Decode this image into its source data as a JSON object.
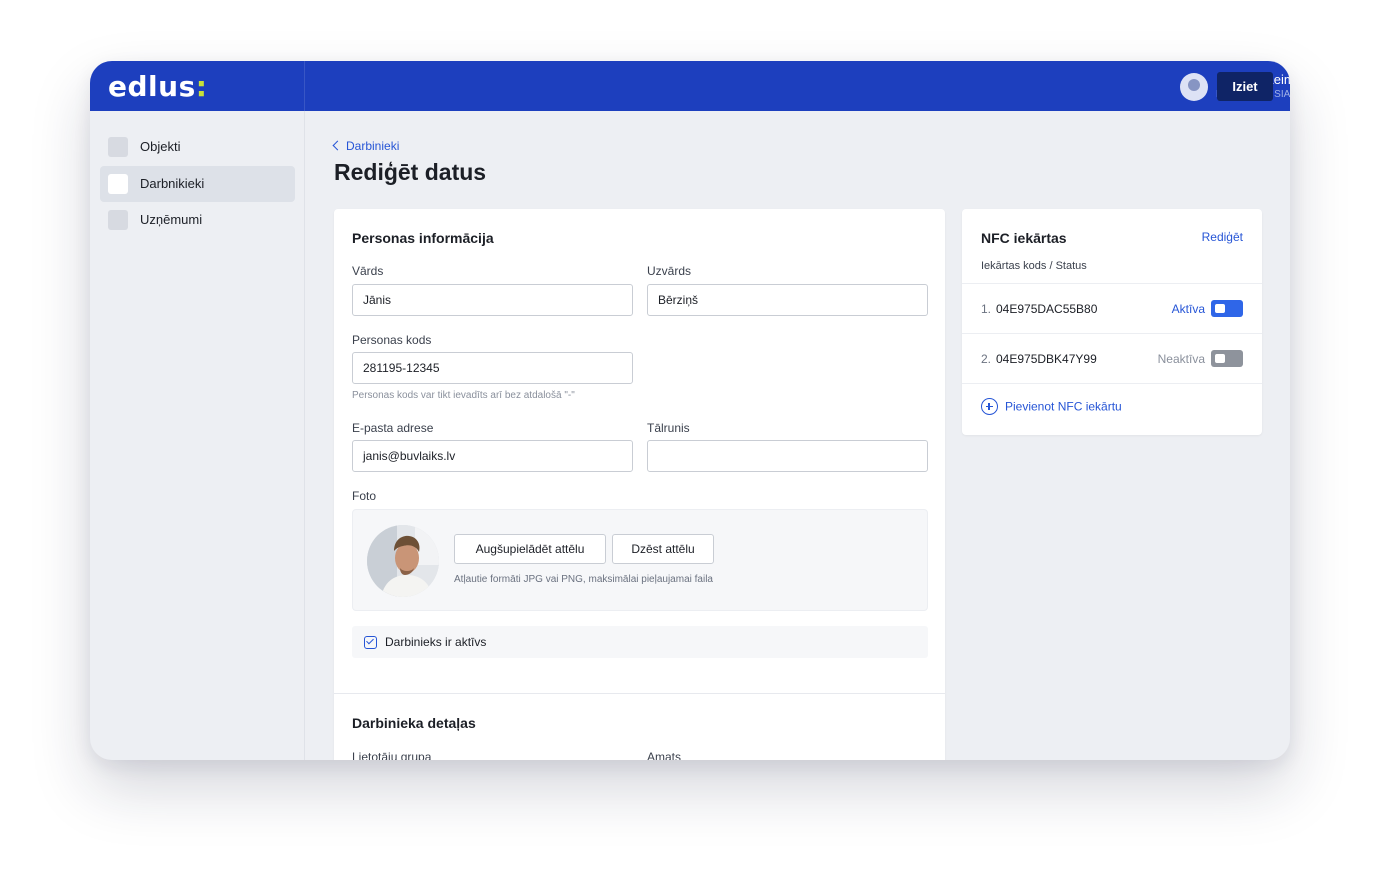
{
  "brand": {
    "name": "edlus",
    "colon": ":"
  },
  "user": {
    "name": "Kristaps Leimanis",
    "company": "PMTT Būve, SIA",
    "logout_label": "Iziet"
  },
  "sidebar": {
    "items": [
      {
        "label": "Objekti",
        "active": false
      },
      {
        "label": "Darbnikieki",
        "active": true
      },
      {
        "label": "Uzņēmumi",
        "active": false
      }
    ]
  },
  "page": {
    "back_label": "Darbinieki",
    "title": "Rediģēt datus"
  },
  "form": {
    "section_title": "Personas informācija",
    "first_name": {
      "label": "Vārds",
      "value": "Jānis"
    },
    "last_name": {
      "label": "Uzvārds",
      "value": "Bērziņš"
    },
    "personal_code": {
      "label": "Personas kods",
      "value": "281195-12345",
      "hint": "Personas kods var tikt ievadīts arī bez atdalošā \"-\""
    },
    "email": {
      "label": "E-pasta adrese",
      "value": "janis@buvlaiks.lv"
    },
    "phone": {
      "label": "Tālrunis",
      "value": ""
    },
    "photo": {
      "label": "Foto",
      "upload_label": "Augšupielādēt attēlu",
      "delete_label": "Dzēst attēlu",
      "hint": "Atļautie formāti JPG vai PNG, maksimālai pieļaujamai faila"
    },
    "active_checkbox": {
      "label": "Darbinieks ir aktīvs",
      "checked": true
    },
    "details": {
      "section_title": "Darbinieka detaļas",
      "group_label": "Lietotāju grupa",
      "position_label": "Amats"
    }
  },
  "nfc": {
    "title": "NFC iekārtas",
    "edit_label": "Rediģēt",
    "subtitle": "Iekārtas kods / Status",
    "devices": [
      {
        "num": "1.",
        "code": "04E975DAC55B80",
        "status": "Aktīva",
        "active": true,
        "status_color": "#2655d6",
        "toggle_color": "#2f66e8"
      },
      {
        "num": "2.",
        "code": "04E975DBK47Y99",
        "status": "Neaktīva",
        "active": false,
        "status_color": "#8a909c",
        "toggle_color": "#8e939c"
      }
    ],
    "add_label": "Pievienot NFC iekārtu"
  },
  "colors": {
    "brand_blue": "#1d3fbe",
    "accent_blue": "#2655d6",
    "logo_green": "#c8e23a",
    "logout_navy": "#0f2466"
  }
}
